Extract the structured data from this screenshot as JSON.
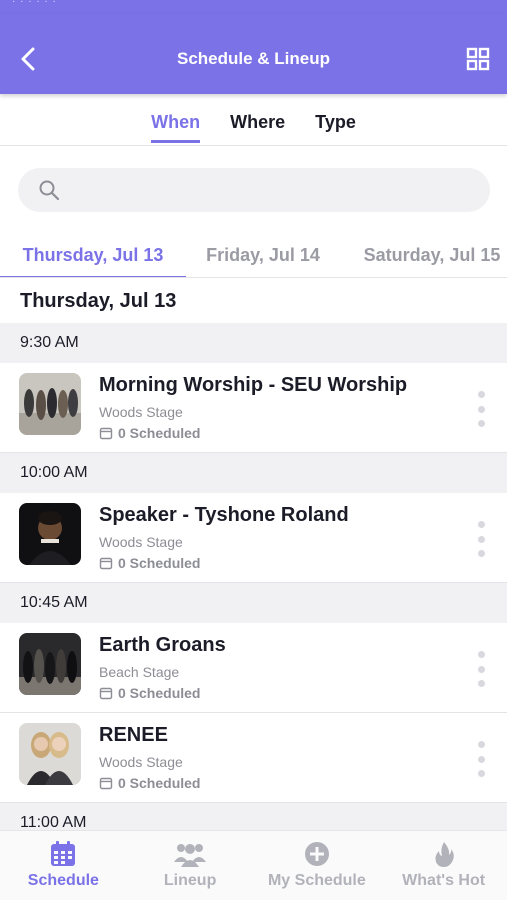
{
  "header": {
    "title": "Schedule & Lineup"
  },
  "filter_tabs": [
    {
      "label": "When",
      "active": true
    },
    {
      "label": "Where",
      "active": false
    },
    {
      "label": "Type",
      "active": false
    }
  ],
  "search": {
    "placeholder": ""
  },
  "day_tabs": [
    {
      "label": "Thursday, Jul 13",
      "active": true
    },
    {
      "label": "Friday, Jul 14",
      "active": false
    },
    {
      "label": "Saturday, Jul 15",
      "active": false
    }
  ],
  "date_heading": "Thursday, Jul 13",
  "times": [
    "9:30 AM",
    "10:00 AM",
    "10:45 AM",
    "11:00 AM"
  ],
  "events": [
    {
      "title": "Morning Worship - SEU Worship",
      "stage": "Woods Stage",
      "scheduled": "0 Scheduled"
    },
    {
      "title": "Speaker - Tyshone Roland",
      "stage": "Woods Stage",
      "scheduled": "0 Scheduled"
    },
    {
      "title": "Earth Groans",
      "stage": "Beach Stage",
      "scheduled": "0 Scheduled"
    },
    {
      "title": "RENEE",
      "stage": "Woods Stage",
      "scheduled": "0 Scheduled"
    }
  ],
  "bottom_nav": [
    {
      "label": "Schedule",
      "icon": "calendar-icon",
      "active": true
    },
    {
      "label": "Lineup",
      "icon": "people-icon",
      "active": false
    },
    {
      "label": "My Schedule",
      "icon": "plus-circle-icon",
      "active": false
    },
    {
      "label": "What's Hot",
      "icon": "flame-icon",
      "active": false
    }
  ],
  "colors": {
    "accent": "#7a72e6",
    "muted": "#8d8d96",
    "section_bg": "#f1f1f3"
  }
}
